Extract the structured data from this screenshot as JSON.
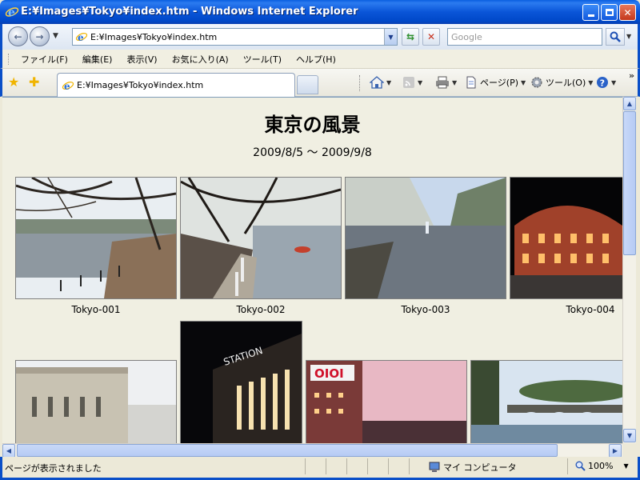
{
  "window": {
    "title": "E:¥Images¥Tokyo¥index.htm - Windows Internet Explorer"
  },
  "toolbar": {
    "address": "E:¥Images¥Tokyo¥index.htm",
    "search_placeholder": "Google"
  },
  "menu": {
    "items": [
      "ファイル(F)",
      "編集(E)",
      "表示(V)",
      "お気に入り(A)",
      "ツール(T)",
      "ヘルプ(H)"
    ]
  },
  "tab": {
    "label": "E:¥Images¥Tokyo¥index.htm"
  },
  "commandbar": {
    "page_label": "ページ(P)",
    "tools_label": "ツール(O)"
  },
  "page": {
    "title": "東京の風景",
    "date_range": "2009/8/5 ～ 2009/9/8",
    "photos": [
      {
        "caption": "Tokyo-001"
      },
      {
        "caption": "Tokyo-002"
      },
      {
        "caption": "Tokyo-003"
      },
      {
        "caption": "Tokyo-004"
      }
    ]
  },
  "status": {
    "text": "ページが表示されました",
    "zone": "マイ コンピュータ",
    "zoom": "100%"
  },
  "colors": {
    "frame_blue": "#0a4fc8",
    "content_background": "#f0efe2"
  }
}
